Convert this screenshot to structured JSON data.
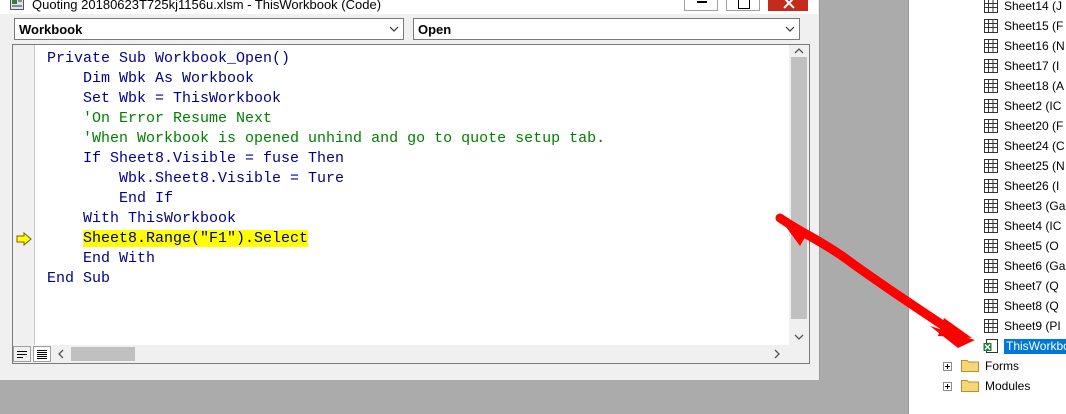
{
  "window": {
    "title": "Quoting 20180623T725kj1156u.xlsm - ThisWorkbook (Code)"
  },
  "object_combo": {
    "value": "Workbook"
  },
  "procedure_combo": {
    "value": "Open"
  },
  "code_lines": [
    {
      "text": "Private Sub Workbook_Open()",
      "indent": 0,
      "style": "code"
    },
    {
      "text": "Dim Wbk As Workbook",
      "indent": 1,
      "style": "code"
    },
    {
      "text": "Set Wbk = ThisWorkbook",
      "indent": 1,
      "style": "code"
    },
    {
      "text": "'On Error Resume Next",
      "indent": 1,
      "style": "comment"
    },
    {
      "text": "'When Workbook is opened unhind and go to quote setup tab.",
      "indent": 1,
      "style": "comment"
    },
    {
      "text": "If Sheet8.Visible = fuse Then",
      "indent": 1,
      "style": "code"
    },
    {
      "text": "Wbk.Sheet8.Visible = Ture",
      "indent": 2,
      "style": "code"
    },
    {
      "text": "End If",
      "indent": 2,
      "style": "code"
    },
    {
      "text": "With ThisWorkbook",
      "indent": 1,
      "style": "code"
    },
    {
      "text": "Sheet8.Range(\"F1\").Select",
      "indent": 1,
      "style": "highlight"
    },
    {
      "text": "End With",
      "indent": 1,
      "style": "code"
    },
    {
      "text": "End Sub",
      "indent": 0,
      "style": "code"
    }
  ],
  "execution_line_index": 9,
  "project_tree": {
    "sheets": [
      "Sheet14 (J",
      "Sheet15 (F",
      "Sheet16 (N",
      "Sheet17 (I",
      "Sheet18 (A",
      "Sheet2 (IC",
      "Sheet20 (F",
      "Sheet24 (C",
      "Sheet25 (N",
      "Sheet26 (I",
      "Sheet3 (Ga",
      "Sheet4 (IC",
      "Sheet5 (O",
      "Sheet6 (Ga",
      "Sheet7 (Q",
      "Sheet8 (Q",
      "Sheet9 (PI"
    ],
    "selected": "ThisWorkbo",
    "folders": [
      "Forms",
      "Modules"
    ]
  },
  "colors": {
    "keyword": "#00008b",
    "comment": "#008000",
    "highlight": "#ffff00",
    "selection": "#0078d7",
    "annotation_arrow": "#ff0000"
  }
}
